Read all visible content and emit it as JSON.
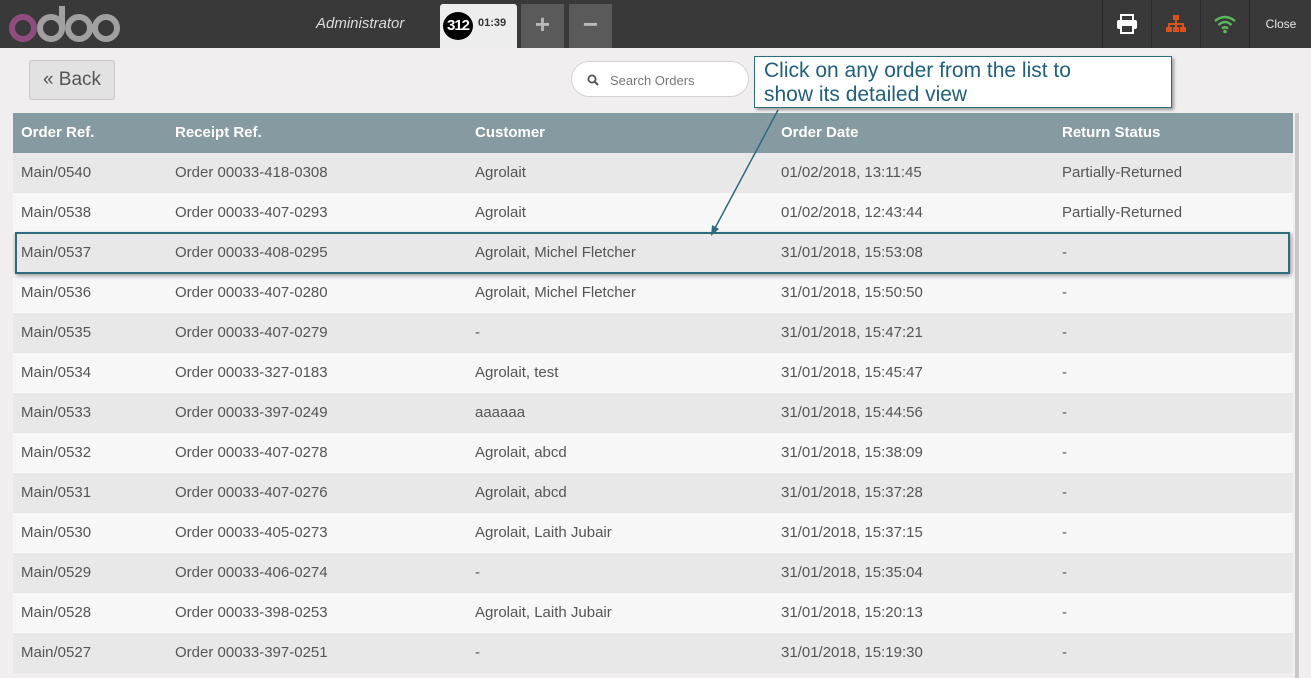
{
  "header": {
    "brand": "odoo",
    "cashier": "Administrator",
    "order_tab": {
      "number": "312",
      "time": "01:39"
    },
    "add_order_label": "+",
    "remove_order_label": "−",
    "close_label": "Close",
    "icons": [
      "print-icon",
      "network-icon",
      "wifi-icon"
    ],
    "colors": {
      "brand_purple": "#8f4d7f",
      "brand_gray": "#a0a0a0",
      "wifi_green": "#5cb85c",
      "network_orange": "#d9531e"
    }
  },
  "toolbar": {
    "back_label": "Back",
    "search_placeholder": "Search Orders"
  },
  "annotation": {
    "callout_line1": "Click on any order from the list to",
    "callout_line2": "show its detailed view"
  },
  "table": {
    "columns": [
      "Order Ref.",
      "Receipt Ref.",
      "Customer",
      "Order Date",
      "Return Status"
    ],
    "rows": [
      [
        "Main/0540",
        "Order 00033-418-0308",
        "Agrolait",
        "01/02/2018, 13:11:45",
        "Partially-Returned"
      ],
      [
        "Main/0538",
        "Order 00033-407-0293",
        "Agrolait",
        "01/02/2018, 12:43:44",
        "Partially-Returned"
      ],
      [
        "Main/0537",
        "Order 00033-408-0295",
        "Agrolait, Michel Fletcher",
        "31/01/2018, 15:53:08",
        "-"
      ],
      [
        "Main/0536",
        "Order 00033-407-0280",
        "Agrolait, Michel Fletcher",
        "31/01/2018, 15:50:50",
        "-"
      ],
      [
        "Main/0535",
        "Order 00033-407-0279",
        "-",
        "31/01/2018, 15:47:21",
        "-"
      ],
      [
        "Main/0534",
        "Order 00033-327-0183",
        "Agrolait, test",
        "31/01/2018, 15:45:47",
        "-"
      ],
      [
        "Main/0533",
        "Order 00033-397-0249",
        "aaaaaa",
        "31/01/2018, 15:44:56",
        "-"
      ],
      [
        "Main/0532",
        "Order 00033-407-0278",
        "Agrolait, abcd",
        "31/01/2018, 15:38:09",
        "-"
      ],
      [
        "Main/0531",
        "Order 00033-407-0276",
        "Agrolait, abcd",
        "31/01/2018, 15:37:28",
        "-"
      ],
      [
        "Main/0530",
        "Order 00033-405-0273",
        "Agrolait, Laith Jubair",
        "31/01/2018, 15:37:15",
        "-"
      ],
      [
        "Main/0529",
        "Order 00033-406-0274",
        "-",
        "31/01/2018, 15:35:04",
        "-"
      ],
      [
        "Main/0528",
        "Order 00033-398-0253",
        "Agrolait, Laith Jubair",
        "31/01/2018, 15:20:13",
        "-"
      ],
      [
        "Main/0527",
        "Order 00033-397-0251",
        "-",
        "31/01/2018, 15:19:30",
        "-"
      ]
    ]
  }
}
